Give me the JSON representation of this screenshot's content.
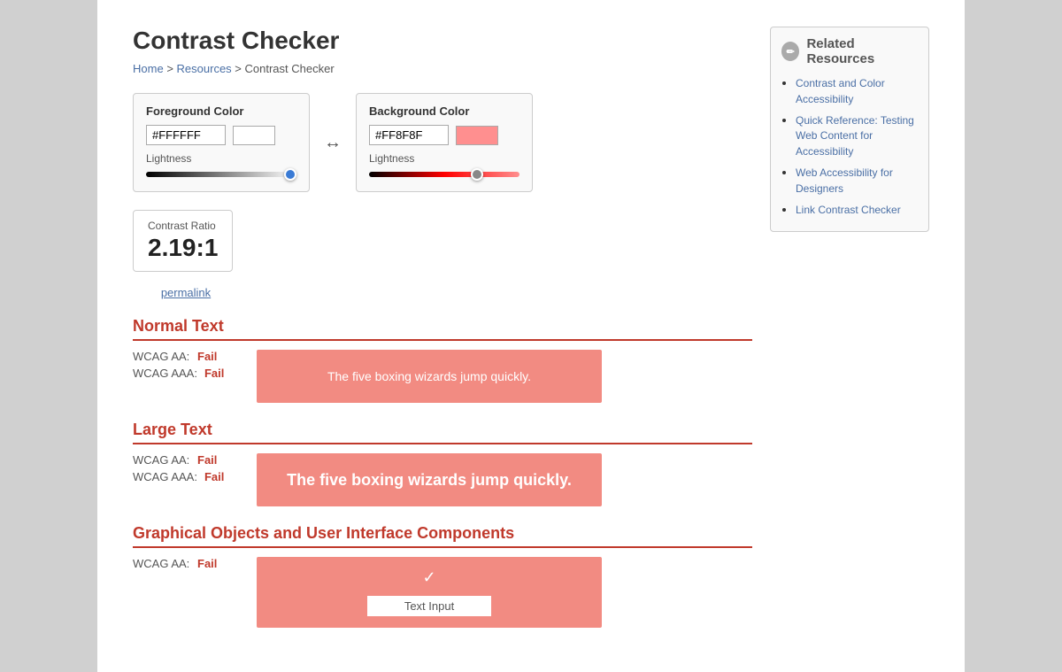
{
  "page": {
    "title": "Contrast Checker",
    "breadcrumb": {
      "home": "Home",
      "resources": "Resources",
      "current": "Contrast Checker"
    }
  },
  "sidebar": {
    "header": "Related Resources",
    "icon": "✏",
    "links": [
      {
        "label": "Contrast and Color Accessibility",
        "href": "#"
      },
      {
        "label": "Quick Reference: Testing Web Content for Accessibility",
        "href": "#"
      },
      {
        "label": "Web Accessibility for Designers",
        "href": "#"
      },
      {
        "label": "Link Contrast Checker",
        "href": "#"
      }
    ]
  },
  "foreground": {
    "label": "Foreground Color",
    "hex": "#FFFFFF",
    "lightness_label": "Lightness"
  },
  "background": {
    "label": "Background Color",
    "hex": "#FF8F8F",
    "lightness_label": "Lightness"
  },
  "contrast": {
    "label": "Contrast Ratio",
    "value": "2.19",
    "colon": ":1",
    "permalink": "permalink"
  },
  "sections": [
    {
      "title": "Normal Text",
      "wcag_aa_label": "WCAG AA:",
      "wcag_aaa_label": "WCAG AAA:",
      "wcag_aa_result": "Fail",
      "wcag_aaa_result": "Fail",
      "preview_text": "The five boxing wizards jump quickly.",
      "preview_large": false
    },
    {
      "title": "Large Text",
      "wcag_aa_label": "WCAG AA:",
      "wcag_aaa_label": "WCAG AAA:",
      "wcag_aa_result": "Fail",
      "wcag_aaa_result": "Fail",
      "preview_text": "The five boxing wizards jump quickly.",
      "preview_large": true
    },
    {
      "title": "Graphical Objects and User Interface Components",
      "wcag_aa_label": "WCAG AA:",
      "wcag_aa_result": "Fail",
      "preview_checkmark": "✓",
      "preview_input": "Text Input",
      "preview_large": false
    }
  ]
}
